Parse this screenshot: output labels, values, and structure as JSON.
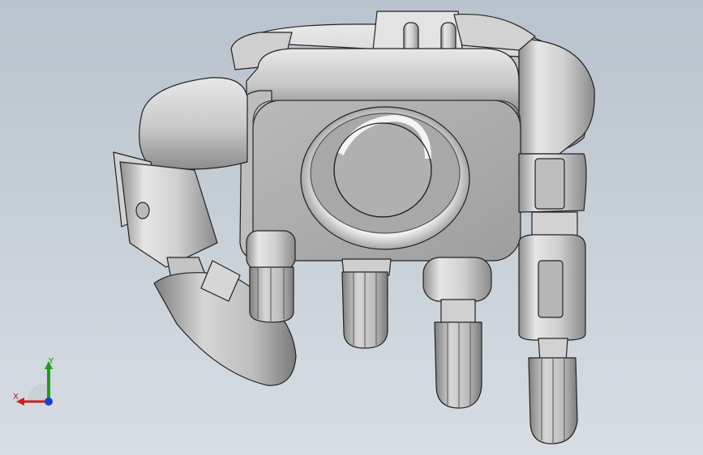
{
  "viewport": {
    "background_top": "#b9c3cd",
    "background_bottom": "#d7dde3"
  },
  "model": {
    "part_fill": "#d8d8d8",
    "part_shade": "#a9a9a9",
    "part_edge": "#222222"
  },
  "triad": {
    "x_label": "X",
    "y_label": "Y",
    "x_color": "#cc1f1f",
    "y_color": "#1f9a1f",
    "z_color": "#1f3fcf"
  }
}
